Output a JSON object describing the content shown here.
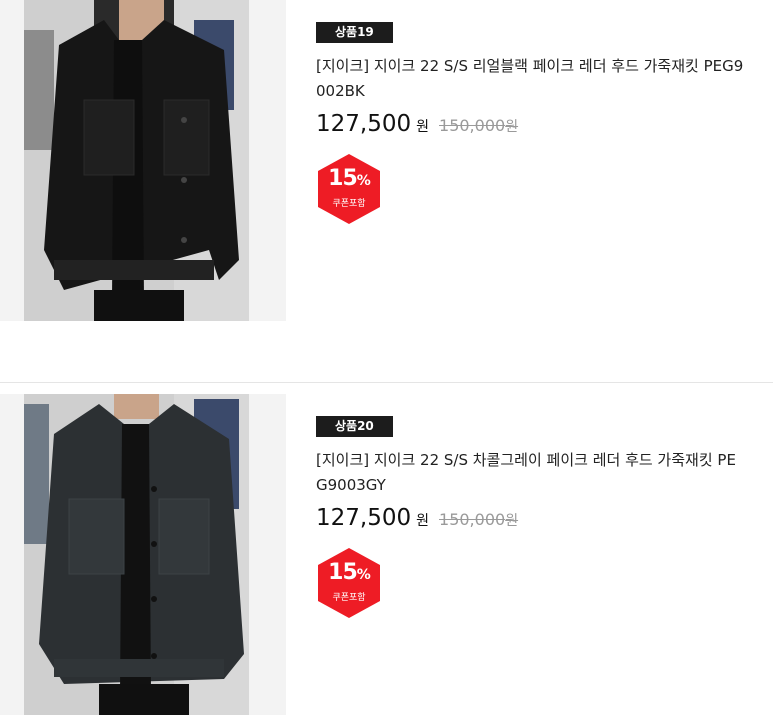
{
  "products": [
    {
      "badge": "상품19",
      "title": "[지이크] 지이크 22 S/S 리얼블랙 페이크 레더 후드 가죽재킷 PEG9002BK",
      "price": "127,500",
      "currency": "원",
      "original_price": "150,000",
      "original_currency": "원",
      "discount_number": "15",
      "discount_sign": "%",
      "coupon_label": "쿠폰포함",
      "image_icon": "leather-jacket-photo",
      "jacket_color": "#1a1a1a"
    },
    {
      "badge": "상품20",
      "title": "[지이크] 지이크 22 S/S 차콜그레이 페이크 레더 후드 가죽재킷 PEG9003GY",
      "price": "127,500",
      "currency": "원",
      "original_price": "150,000",
      "original_currency": "원",
      "discount_number": "15",
      "discount_sign": "%",
      "coupon_label": "쿠폰포함",
      "image_icon": "leather-jacket-photo",
      "jacket_color": "#2c3033"
    }
  ],
  "colors": {
    "badge_bg": "#1c1c1c",
    "coupon_red": "#ee1c25",
    "strike_gray": "#9a9a9a"
  }
}
